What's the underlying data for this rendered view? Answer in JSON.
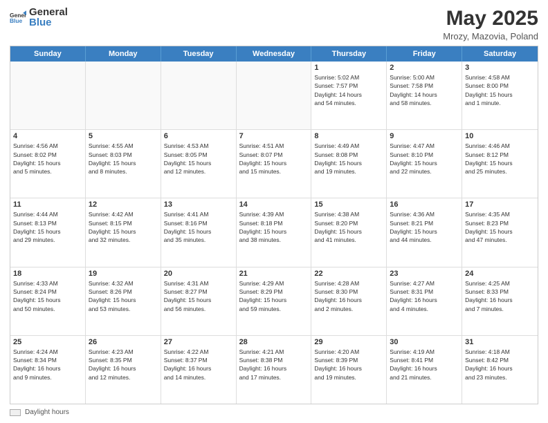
{
  "header": {
    "logo_general": "General",
    "logo_blue": "Blue",
    "title": "May 2025",
    "subtitle": "Mrozy, Mazovia, Poland"
  },
  "calendar": {
    "days_of_week": [
      "Sunday",
      "Monday",
      "Tuesday",
      "Wednesday",
      "Thursday",
      "Friday",
      "Saturday"
    ],
    "weeks": [
      [
        {
          "day": "",
          "info": "",
          "empty": true
        },
        {
          "day": "",
          "info": "",
          "empty": true
        },
        {
          "day": "",
          "info": "",
          "empty": true
        },
        {
          "day": "",
          "info": "",
          "empty": true
        },
        {
          "day": "1",
          "info": "Sunrise: 5:02 AM\nSunset: 7:57 PM\nDaylight: 14 hours\nand 54 minutes.",
          "empty": false
        },
        {
          "day": "2",
          "info": "Sunrise: 5:00 AM\nSunset: 7:58 PM\nDaylight: 14 hours\nand 58 minutes.",
          "empty": false
        },
        {
          "day": "3",
          "info": "Sunrise: 4:58 AM\nSunset: 8:00 PM\nDaylight: 15 hours\nand 1 minute.",
          "empty": false
        }
      ],
      [
        {
          "day": "4",
          "info": "Sunrise: 4:56 AM\nSunset: 8:02 PM\nDaylight: 15 hours\nand 5 minutes.",
          "empty": false
        },
        {
          "day": "5",
          "info": "Sunrise: 4:55 AM\nSunset: 8:03 PM\nDaylight: 15 hours\nand 8 minutes.",
          "empty": false
        },
        {
          "day": "6",
          "info": "Sunrise: 4:53 AM\nSunset: 8:05 PM\nDaylight: 15 hours\nand 12 minutes.",
          "empty": false
        },
        {
          "day": "7",
          "info": "Sunrise: 4:51 AM\nSunset: 8:07 PM\nDaylight: 15 hours\nand 15 minutes.",
          "empty": false
        },
        {
          "day": "8",
          "info": "Sunrise: 4:49 AM\nSunset: 8:08 PM\nDaylight: 15 hours\nand 19 minutes.",
          "empty": false
        },
        {
          "day": "9",
          "info": "Sunrise: 4:47 AM\nSunset: 8:10 PM\nDaylight: 15 hours\nand 22 minutes.",
          "empty": false
        },
        {
          "day": "10",
          "info": "Sunrise: 4:46 AM\nSunset: 8:12 PM\nDaylight: 15 hours\nand 25 minutes.",
          "empty": false
        }
      ],
      [
        {
          "day": "11",
          "info": "Sunrise: 4:44 AM\nSunset: 8:13 PM\nDaylight: 15 hours\nand 29 minutes.",
          "empty": false
        },
        {
          "day": "12",
          "info": "Sunrise: 4:42 AM\nSunset: 8:15 PM\nDaylight: 15 hours\nand 32 minutes.",
          "empty": false
        },
        {
          "day": "13",
          "info": "Sunrise: 4:41 AM\nSunset: 8:16 PM\nDaylight: 15 hours\nand 35 minutes.",
          "empty": false
        },
        {
          "day": "14",
          "info": "Sunrise: 4:39 AM\nSunset: 8:18 PM\nDaylight: 15 hours\nand 38 minutes.",
          "empty": false
        },
        {
          "day": "15",
          "info": "Sunrise: 4:38 AM\nSunset: 8:20 PM\nDaylight: 15 hours\nand 41 minutes.",
          "empty": false
        },
        {
          "day": "16",
          "info": "Sunrise: 4:36 AM\nSunset: 8:21 PM\nDaylight: 15 hours\nand 44 minutes.",
          "empty": false
        },
        {
          "day": "17",
          "info": "Sunrise: 4:35 AM\nSunset: 8:23 PM\nDaylight: 15 hours\nand 47 minutes.",
          "empty": false
        }
      ],
      [
        {
          "day": "18",
          "info": "Sunrise: 4:33 AM\nSunset: 8:24 PM\nDaylight: 15 hours\nand 50 minutes.",
          "empty": false
        },
        {
          "day": "19",
          "info": "Sunrise: 4:32 AM\nSunset: 8:26 PM\nDaylight: 15 hours\nand 53 minutes.",
          "empty": false
        },
        {
          "day": "20",
          "info": "Sunrise: 4:31 AM\nSunset: 8:27 PM\nDaylight: 15 hours\nand 56 minutes.",
          "empty": false
        },
        {
          "day": "21",
          "info": "Sunrise: 4:29 AM\nSunset: 8:29 PM\nDaylight: 15 hours\nand 59 minutes.",
          "empty": false
        },
        {
          "day": "22",
          "info": "Sunrise: 4:28 AM\nSunset: 8:30 PM\nDaylight: 16 hours\nand 2 minutes.",
          "empty": false
        },
        {
          "day": "23",
          "info": "Sunrise: 4:27 AM\nSunset: 8:31 PM\nDaylight: 16 hours\nand 4 minutes.",
          "empty": false
        },
        {
          "day": "24",
          "info": "Sunrise: 4:25 AM\nSunset: 8:33 PM\nDaylight: 16 hours\nand 7 minutes.",
          "empty": false
        }
      ],
      [
        {
          "day": "25",
          "info": "Sunrise: 4:24 AM\nSunset: 8:34 PM\nDaylight: 16 hours\nand 9 minutes.",
          "empty": false
        },
        {
          "day": "26",
          "info": "Sunrise: 4:23 AM\nSunset: 8:35 PM\nDaylight: 16 hours\nand 12 minutes.",
          "empty": false
        },
        {
          "day": "27",
          "info": "Sunrise: 4:22 AM\nSunset: 8:37 PM\nDaylight: 16 hours\nand 14 minutes.",
          "empty": false
        },
        {
          "day": "28",
          "info": "Sunrise: 4:21 AM\nSunset: 8:38 PM\nDaylight: 16 hours\nand 17 minutes.",
          "empty": false
        },
        {
          "day": "29",
          "info": "Sunrise: 4:20 AM\nSunset: 8:39 PM\nDaylight: 16 hours\nand 19 minutes.",
          "empty": false
        },
        {
          "day": "30",
          "info": "Sunrise: 4:19 AM\nSunset: 8:41 PM\nDaylight: 16 hours\nand 21 minutes.",
          "empty": false
        },
        {
          "day": "31",
          "info": "Sunrise: 4:18 AM\nSunset: 8:42 PM\nDaylight: 16 hours\nand 23 minutes.",
          "empty": false
        }
      ]
    ]
  },
  "footer": {
    "daylight_label": "Daylight hours"
  }
}
